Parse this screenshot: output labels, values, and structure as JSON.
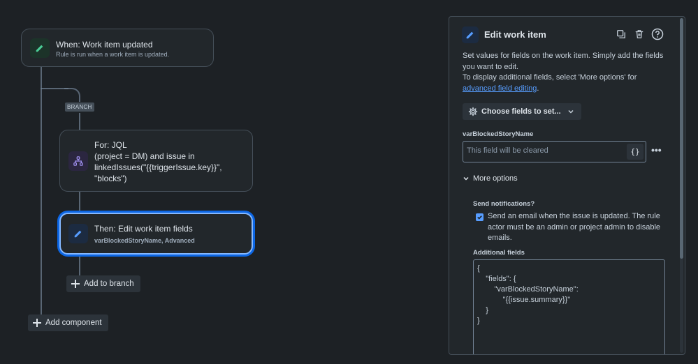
{
  "trigger": {
    "title": "When: Work item updated",
    "subtitle": "Rule is run when a work item is updated.",
    "icon": "pencil-icon",
    "accent": "#4bce97"
  },
  "branch_tag": "BRANCH",
  "branch_card": {
    "lines": [
      "For: JQL",
      "(project = DM) and issue in",
      "linkedIssues(\"{{triggerIssue.key}}\",",
      "\"blocks\")"
    ],
    "icon": "hierarchy-icon",
    "accent": "#9f8fef"
  },
  "action_card": {
    "title": "Then: Edit work item fields",
    "subtitle_bold": "varBlockedStoryName",
    "subtitle_rest": ", Advanced",
    "icon": "pencil-icon",
    "accent": "#579dff"
  },
  "add_to_branch_label": "Add to branch",
  "add_component_label": "Add component",
  "panel": {
    "title": "Edit work item",
    "desc_line1": "Set values for fields on the work item. Simply add the fields you want to edit.",
    "desc_line2": "To display additional fields, select 'More options' for",
    "desc_link": "advanced field editing",
    "desc_end": ".",
    "choose_fields_label": "Choose fields to set...",
    "field_label": "varBlockedStoryName",
    "field_placeholder": "This field will be cleared",
    "braces_label": "{}",
    "more_dots": "•••",
    "more_options_label": "More options",
    "send_notifications_label": "Send notifications?",
    "send_email_text": "Send an email when the issue is updated. The rule actor must be an admin or project admin to disable emails.",
    "send_email_checked": true,
    "additional_fields_label": "Additional fields",
    "additional_fields_lines": [
      "{",
      "    \"fields\": {",
      "        \"varBlockedStoryName\":",
      "            \"{{issue.summary}}\"",
      "    }",
      "}"
    ]
  }
}
